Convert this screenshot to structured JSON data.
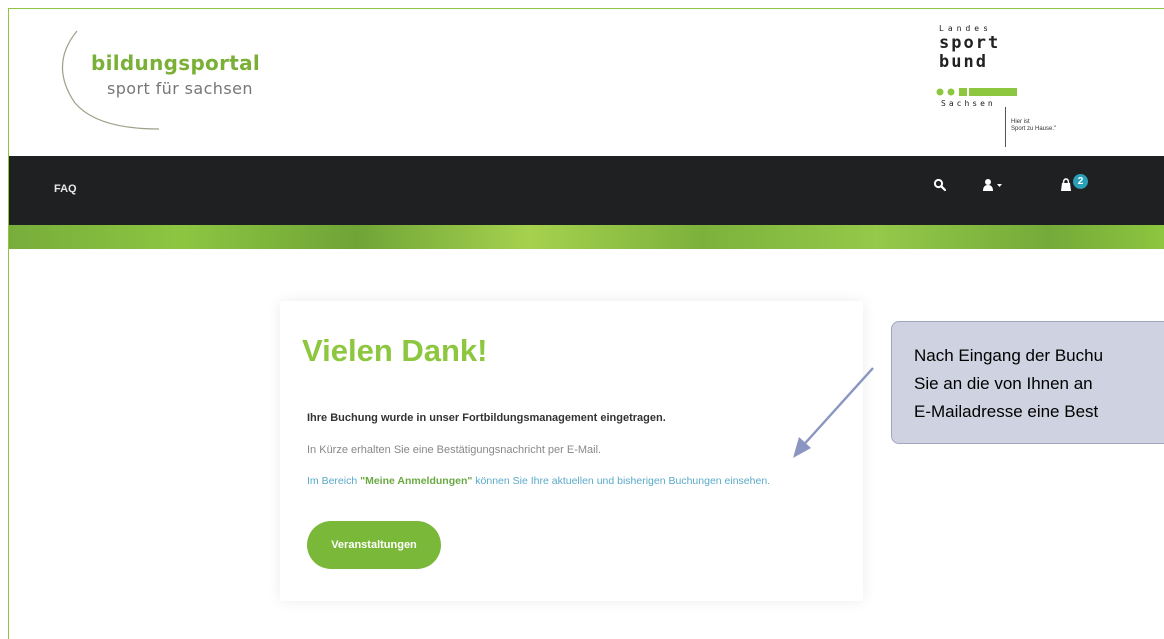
{
  "header": {
    "logo_left": {
      "name": "bildungsportal",
      "tagline": "sport für sachsen"
    },
    "logo_right": {
      "line1": "Landes",
      "line2": "sport",
      "line3": "bund",
      "line4": "Sachsen",
      "slogan_line1": "Hier ist",
      "slogan_line2": "Sport zu Hause.\""
    }
  },
  "nav": {
    "faq_label": "FAQ",
    "icons": [
      "search-icon",
      "user-icon",
      "cart-icon"
    ],
    "cart_count": "2"
  },
  "confirmation": {
    "title": "Vielen Dank!",
    "line1": "Ihre Buchung wurde in unser Fortbildungsmanagement eingetragen.",
    "line2": "In Kürze erhalten Sie eine Bestätigungsnachricht per E-Mail.",
    "line3_prefix": "Im Bereich ",
    "line3_link": "\"Meine Anmeldungen\"",
    "line3_suffix": " können Sie Ihre aktuellen und bisherigen Buchungen einsehen.",
    "button_label": "Veranstaltungen"
  },
  "callout": {
    "line1": "Nach Eingang der Buchu",
    "line2": "Sie an die von Ihnen an",
    "line3": "E-Mailadresse eine Best"
  },
  "colors": {
    "brand_green": "#8dc63f",
    "nav_dark": "#1f2022",
    "badge_teal": "#2aa0b8",
    "callout_bg": "#cfd3e1"
  }
}
